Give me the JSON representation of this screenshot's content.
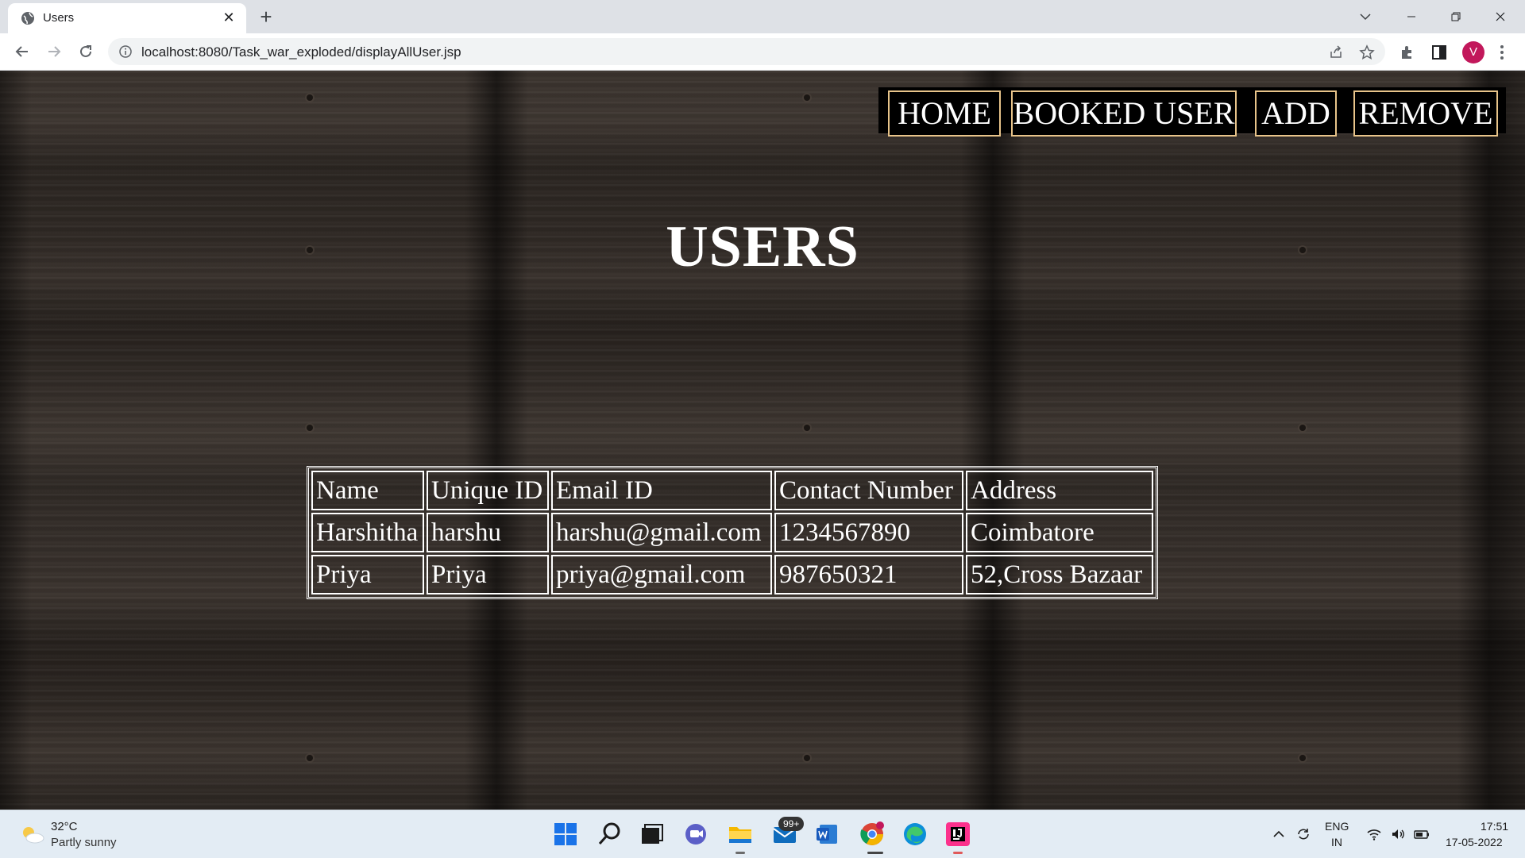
{
  "browser": {
    "tab_title": "Users",
    "new_tab_symbol": "+",
    "close_symbol": "✕",
    "url": "localhost:8080/Task_war_exploded/displayAllUser.jsp",
    "profile_initial": "V"
  },
  "nav": {
    "home": "HOME",
    "booked_user": "BOOKED USER",
    "add": "ADD",
    "remove": "REMOVE"
  },
  "page": {
    "title": "USERS"
  },
  "table": {
    "headers": [
      "Name",
      "Unique ID",
      "Email ID",
      "Contact Number",
      "Address"
    ],
    "rows": [
      [
        "Harshitha",
        "harshu",
        "harshu@gmail.com",
        "1234567890",
        "Coimbatore"
      ],
      [
        "Priya",
        "Priya",
        "priya@gmail.com",
        "987650321",
        "52,Cross Bazaar"
      ]
    ]
  },
  "taskbar": {
    "weather_temp": "32°C",
    "weather_desc": "Partly sunny",
    "mail_badge": "99+",
    "lang_line1": "ENG",
    "lang_line2": "IN",
    "time": "17:51",
    "date": "17-05-2022"
  },
  "colors": {
    "nav_border": "#e8c48a",
    "text": "#ffffff",
    "navbar_bg": "#000000"
  }
}
